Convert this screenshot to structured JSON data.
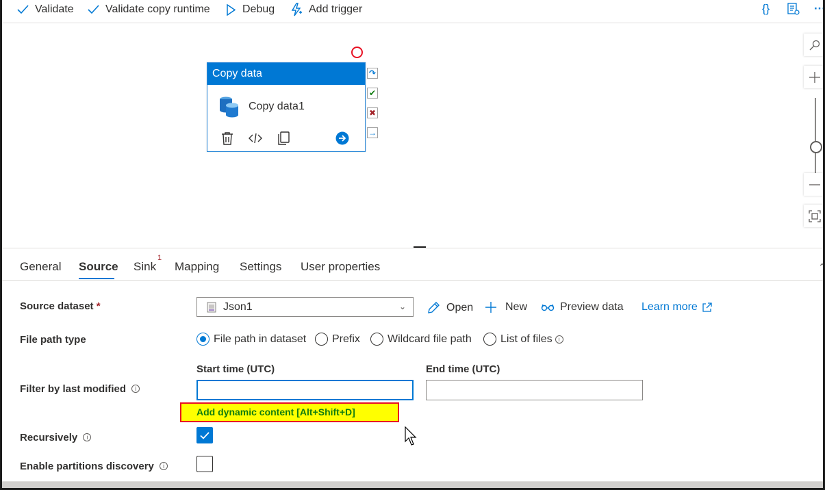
{
  "toolbar": {
    "validate": "Validate",
    "validate_copy_runtime": "Validate copy runtime",
    "debug": "Debug",
    "add_trigger": "Add trigger",
    "code_icon_glyph": "{}",
    "more_glyph": "···"
  },
  "canvas": {
    "activity": {
      "type": "Copy data",
      "name": "Copy data1"
    },
    "ports": [
      "skip",
      "success",
      "failure",
      "completion"
    ],
    "port_colors": {
      "success": "#107c10",
      "failure": "#a4262c",
      "other": "#0078d4"
    }
  },
  "tabs": [
    {
      "label": "General",
      "active": false
    },
    {
      "label": "Source",
      "active": true
    },
    {
      "label": "Sink",
      "active": false,
      "badge": "1"
    },
    {
      "label": "Mapping",
      "active": false
    },
    {
      "label": "Settings",
      "active": false
    },
    {
      "label": "User properties",
      "active": false
    }
  ],
  "form": {
    "source_dataset": {
      "label": "Source dataset",
      "required_mark": "*",
      "value": "Json1",
      "open": "Open",
      "new": "New",
      "preview": "Preview data",
      "learn_more": "Learn more"
    },
    "file_path_type": {
      "label": "File path type",
      "options": [
        "File path in dataset",
        "Prefix",
        "Wildcard file path",
        "List of files"
      ],
      "selected": "File path in dataset"
    },
    "filter": {
      "label": "Filter by last modified",
      "start_label": "Start time (UTC)",
      "end_label": "End time (UTC)",
      "start_value": "",
      "end_value": "",
      "dynamic_content": "Add dynamic content [Alt+Shift+D]"
    },
    "recursively": {
      "label": "Recursively",
      "checked": true
    },
    "partitions": {
      "label": "Enable partitions discovery",
      "checked": false
    }
  },
  "colors": {
    "accent": "#0078d4",
    "highlight": "#ffff00",
    "highlight_border": "#e81123",
    "dynamic_text": "#107c10"
  }
}
